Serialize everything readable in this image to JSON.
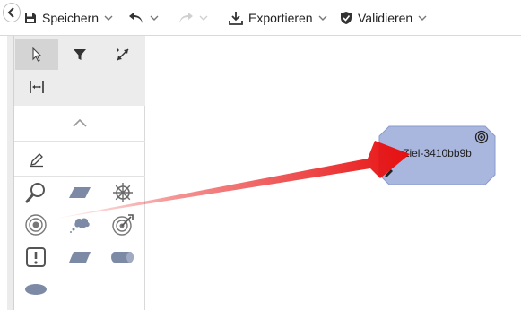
{
  "toolbar": {
    "save_label": "Speichern",
    "export_label": "Exportieren",
    "validate_label": "Validieren"
  },
  "canvas": {
    "node": {
      "label": "Ziel-3410bb9b",
      "fill_color": "#a9b6de",
      "border_color": "#8a9bcc"
    }
  },
  "colors": {
    "arrow": "#e81010",
    "icon": "#555555",
    "shape_fill": "#7d8aa6"
  }
}
